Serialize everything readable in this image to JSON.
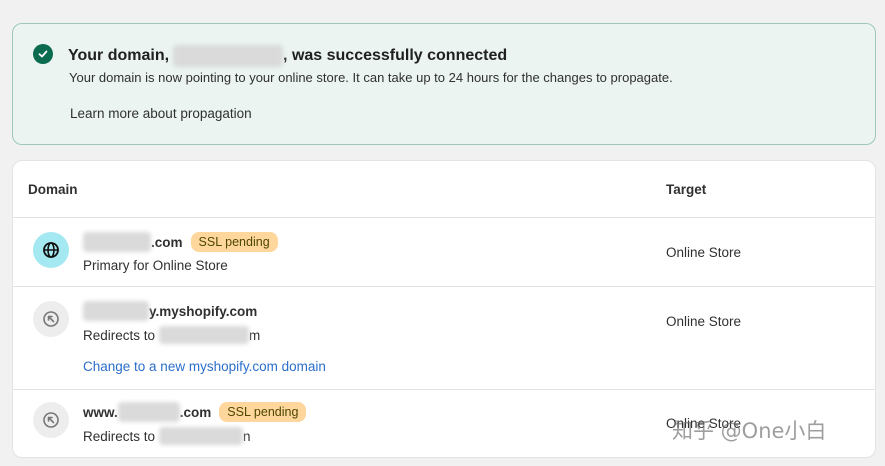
{
  "banner": {
    "title_prefix": "Your domain,",
    "title_suffix": ", was successfully connected",
    "body": "Your domain is now pointing to your online store. It can take up to 24 hours for the changes to propagate.",
    "link": "Learn more about propagation",
    "accent": "#0a6b4f",
    "icon": "check-circle-icon"
  },
  "table": {
    "col_domain": "Domain",
    "col_target": "Target",
    "rows": [
      {
        "domain_suffix": ".com",
        "badge": "SSL pending",
        "sub_prefix": "Primary for Online Store",
        "sub_suffix": "",
        "target": "Online Store",
        "icon": "globe-icon"
      },
      {
        "domain_suffix": "y.myshopify.com",
        "badge": "",
        "sub_prefix": "Redirects to",
        "sub_suffix": "m",
        "link": "Change to a new myshopify.com domain",
        "target": "Online Store",
        "icon": "redirect-arrow-icon"
      },
      {
        "domain_prefix": "www.",
        "domain_suffix": ".com",
        "badge": "SSL pending",
        "sub_prefix": "Redirects to",
        "sub_suffix": "n",
        "target": "Online Store",
        "icon": "redirect-arrow-icon"
      }
    ]
  },
  "watermark": "知乎 @One小白",
  "colors": {
    "badge_bg": "#ffd79d",
    "link": "#2c6ecb",
    "banner_bg": "#ebf4f1"
  }
}
